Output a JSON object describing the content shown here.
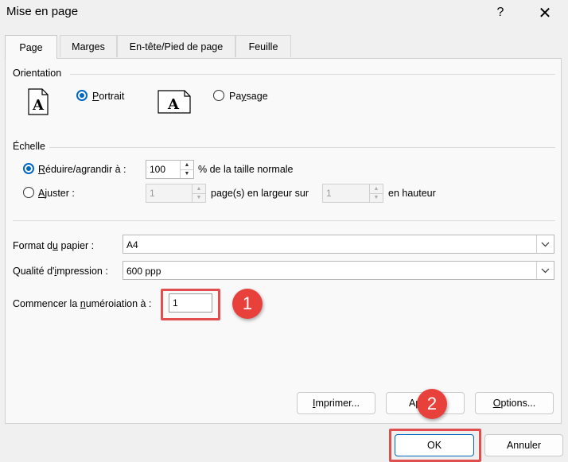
{
  "window": {
    "title": "Mise en page",
    "help_glyph": "?",
    "close_glyph": "✕"
  },
  "tabs": [
    {
      "label": "Page",
      "active": true
    },
    {
      "label": "Marges",
      "active": false
    },
    {
      "label": "En-tête/Pied de page",
      "active": false
    },
    {
      "label": "Feuille",
      "active": false
    }
  ],
  "orientation": {
    "label": "Orientation",
    "portrait": {
      "first": "P",
      "rest": "ortrait",
      "checked": true
    },
    "landscape": {
      "before": "Pa",
      "accel": "y",
      "after": "sage",
      "checked": false
    }
  },
  "scale": {
    "label": "Échelle",
    "adjust_to": {
      "accel": "R",
      "rest": "éduire/agrandir à :",
      "value": "100",
      "suffix": "% de la taille normale",
      "checked": true
    },
    "fit_to": {
      "accel": "A",
      "rest": "juster :",
      "wide_value": "1",
      "middle": "page(s) en largeur sur",
      "tall_value": "1",
      "suffix": "en hauteur",
      "checked": false
    }
  },
  "paper": {
    "before": "Format d",
    "accel": "u",
    "after": " papier :",
    "value": "A4"
  },
  "quality": {
    "before": "Qualité d'",
    "accel": "i",
    "after": "mpression :",
    "value": "600 ppp"
  },
  "first_page": {
    "before": "Commencer la ",
    "accel": "n",
    "after": "uméroiation à :",
    "value": "1"
  },
  "buttons": {
    "print": {
      "accel": "I",
      "rest": "mprimer..."
    },
    "preview": {
      "before": "Ap"
    },
    "options": {
      "accel": "O",
      "rest": "ptions..."
    },
    "ok": "OK",
    "cancel": "Annuler"
  },
  "annotations": [
    {
      "number": "1",
      "color": "#e8413c"
    },
    {
      "number": "2",
      "color": "#e8413c"
    }
  ],
  "colors": {
    "accent": "#0067c0",
    "callout": "#e04e4e"
  }
}
